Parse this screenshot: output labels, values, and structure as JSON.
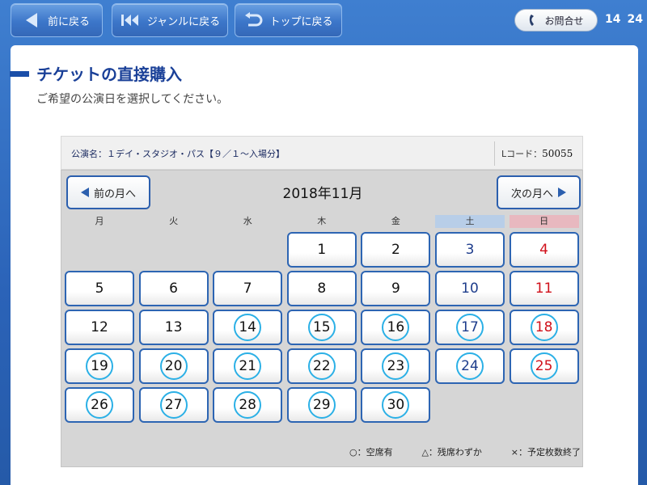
{
  "topbar": {
    "back_label": "前に戻る",
    "genre_label": "ジャンルに戻る",
    "top_label": "トップに戻る",
    "contact_label": "お問合せ",
    "time_hour": "14",
    "time_min": "24"
  },
  "page": {
    "title": "チケットの直接購入",
    "subtitle": "ご希望の公演日を選択してください。"
  },
  "info": {
    "performance": "公演名：１デイ・スタジオ・パス【９／１〜入場分】",
    "lcode_label": "Lコード：",
    "lcode_value": "50055"
  },
  "calendar": {
    "prev_label": "前の月へ",
    "next_label": "次の月へ",
    "month_title": "2018年11月",
    "weekdays": [
      "月",
      "火",
      "水",
      "木",
      "金",
      "土",
      "日"
    ],
    "first_weekday_index": 3,
    "days": [
      {
        "n": "1",
        "avail": false
      },
      {
        "n": "2",
        "avail": false
      },
      {
        "n": "3",
        "avail": false
      },
      {
        "n": "4",
        "avail": false
      },
      {
        "n": "5",
        "avail": false
      },
      {
        "n": "6",
        "avail": false
      },
      {
        "n": "7",
        "avail": false
      },
      {
        "n": "8",
        "avail": false
      },
      {
        "n": "9",
        "avail": false
      },
      {
        "n": "10",
        "avail": false
      },
      {
        "n": "11",
        "avail": false
      },
      {
        "n": "12",
        "avail": false
      },
      {
        "n": "13",
        "avail": false
      },
      {
        "n": "14",
        "avail": true
      },
      {
        "n": "15",
        "avail": true
      },
      {
        "n": "16",
        "avail": true
      },
      {
        "n": "17",
        "avail": true
      },
      {
        "n": "18",
        "avail": true
      },
      {
        "n": "19",
        "avail": true
      },
      {
        "n": "20",
        "avail": true
      },
      {
        "n": "21",
        "avail": true
      },
      {
        "n": "22",
        "avail": true
      },
      {
        "n": "23",
        "avail": true
      },
      {
        "n": "24",
        "avail": true
      },
      {
        "n": "25",
        "avail": true
      },
      {
        "n": "26",
        "avail": true
      },
      {
        "n": "27",
        "avail": true
      },
      {
        "n": "28",
        "avail": true
      },
      {
        "n": "29",
        "avail": true
      },
      {
        "n": "30",
        "avail": true
      }
    ]
  },
  "legend": {
    "available": "○：空席有",
    "few": "△：残席わずか",
    "soldout": "×：予定枚数終了"
  },
  "colors": {
    "accent": "#1a4098",
    "button_border": "#2d65b3",
    "available_ring": "#2bb0e6",
    "saturday": "#1e3d8c",
    "sunday": "#d0101a"
  }
}
